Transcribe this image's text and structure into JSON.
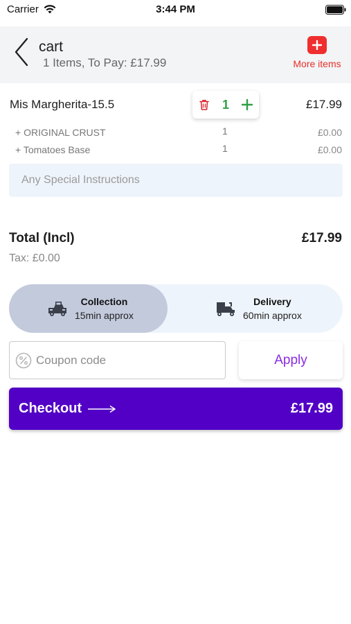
{
  "status_bar": {
    "carrier": "Carrier",
    "time": "3:44 PM"
  },
  "header": {
    "title": "cart",
    "subtitle": "1 Items, To Pay: £17.99",
    "more_items_label": "More items"
  },
  "cart_item": {
    "name": "Mis Margherita-15.5",
    "quantity": "1",
    "price": "£17.99",
    "options": [
      {
        "label": "+ ORIGINAL CRUST",
        "quantity": "1",
        "price": "£0.00"
      },
      {
        "label": "+ Tomatoes Base",
        "quantity": "1",
        "price": "£0.00"
      }
    ]
  },
  "instructions": {
    "placeholder": "Any Special Instructions"
  },
  "totals": {
    "label": "Total (Incl)",
    "value": "£17.99",
    "tax": "Tax: £0.00"
  },
  "order_mode": {
    "selected": "collection",
    "collection": {
      "title": "Collection",
      "subtitle": "15min approx"
    },
    "delivery": {
      "title": "Delivery",
      "subtitle": "60min approx"
    }
  },
  "coupon": {
    "placeholder": "Coupon code",
    "apply_label": "Apply"
  },
  "checkout": {
    "label": "Checkout",
    "total": "£17.99"
  },
  "colors": {
    "accent_purple": "#5200c6",
    "apply_purple": "#8a2be2",
    "danger_red": "#e8302a",
    "qty_green": "#2ea043",
    "selected_mode_bg": "#c3cadc",
    "panel_bg": "#eef4fb"
  }
}
